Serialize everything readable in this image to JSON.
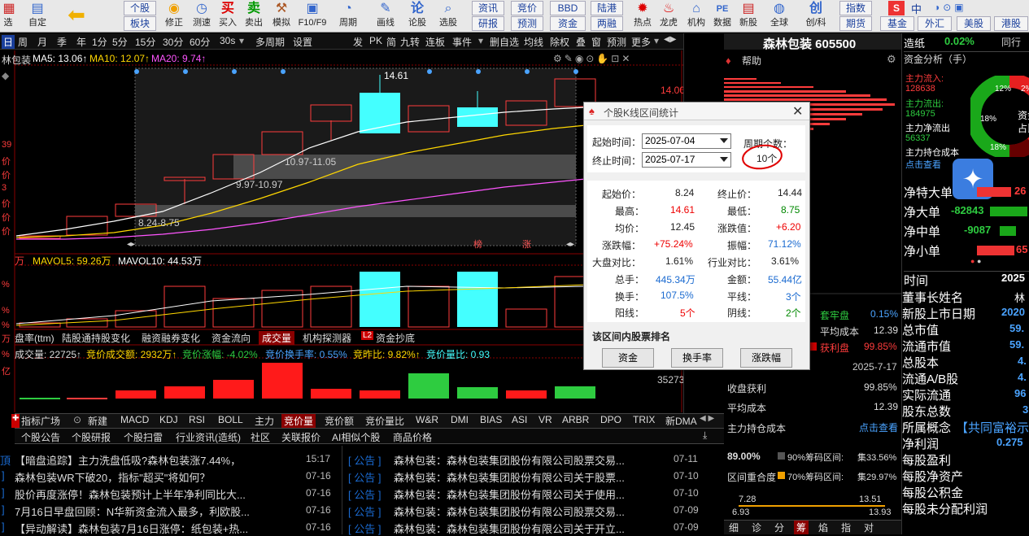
{
  "toolbar": {
    "left_items": [
      {
        "label": "选",
        "icon": "grid-icon"
      },
      {
        "label": "自定",
        "icon": "custom-icon"
      },
      {
        "label": "",
        "icon": "back-arrow-icon"
      },
      {
        "label": "修正",
        "icon": "refresh-icon"
      },
      {
        "label": "测速",
        "icon": "clock-icon"
      },
      {
        "label": "买入",
        "icon": "buy-icon"
      },
      {
        "label": "卖出",
        "icon": "sell-icon"
      },
      {
        "label": "模拟",
        "icon": "hammer-icon"
      },
      {
        "label": "F10/F9",
        "icon": "f10-icon"
      },
      {
        "label": "周期",
        "icon": "period-icon"
      },
      {
        "label": "画线",
        "icon": "draw-icon"
      },
      {
        "label": "论股",
        "icon": "discuss-icon"
      },
      {
        "label": "选股",
        "icon": "select-stock-icon"
      }
    ],
    "small_buttons": {
      "gegu": "个股",
      "bankuai": "板块",
      "zixun": "资讯",
      "yanbao": "研报",
      "jingjia": "竞价",
      "yuce": "预测",
      "bbd": "BBD",
      "zijin": "资金",
      "lugang": "陆港",
      "lianglong": "两融"
    },
    "right_items": [
      {
        "label": "热点",
        "icon": "hot-icon"
      },
      {
        "label": "龙虎",
        "icon": "dragon-icon"
      },
      {
        "label": "机构",
        "icon": "bank-icon"
      },
      {
        "label": "数据",
        "icon": "pe-icon"
      },
      {
        "label": "新股",
        "icon": "new-stock-icon"
      },
      {
        "label": "全球",
        "icon": "globe-icon"
      },
      {
        "label": "创/科",
        "icon": "chuang-icon"
      }
    ],
    "far_right": {
      "zhishu": "指数",
      "qihuo": "期货",
      "jijin": "基金",
      "waihui": "外汇",
      "meigu": "美股",
      "ganggu": "港股",
      "zhong": "中"
    }
  },
  "menubar": {
    "items": [
      "日",
      "周",
      "月",
      "季",
      "年",
      "1分",
      "5分",
      "15分",
      "30分",
      "60分",
      "30s",
      "多周期",
      "设置",
      "发",
      "PK",
      "简",
      "九转",
      "连板",
      "事件",
      "删自选",
      "均线",
      "除权",
      "叠",
      "窗",
      "预测",
      "更多"
    ]
  },
  "main_chart": {
    "ma_line": {
      "name": "林包装",
      "ma5": "MA5: 13.06↑",
      "ma10": "MA10: 12.07↑",
      "ma20": "MA20: 9.74↑"
    },
    "price_labels": {
      "p1461": "14.61",
      "p1400": "14.00",
      "z1": "10.97-11.05",
      "z2": "9.97-10.97",
      "z3": "8.24-8.75"
    },
    "markers": {
      "bang": "榜",
      "zhang": "涨"
    },
    "left_edge": [
      "39",
      "价",
      "价",
      "3",
      "价",
      "价",
      "价"
    ]
  },
  "volume_pane": {
    "header_unit": "万",
    "mavol5": "MAVOL5: 59.26万",
    "mavol10": "MAVOL10: 44.53万",
    "left_edge": [
      "%",
      "%",
      "%",
      "%",
      "万",
      "亿"
    ]
  },
  "sub_tabs": [
    "盘率(ttm)",
    "陆股通持股变化",
    "融资融券变化",
    "资金流向",
    "成交量",
    "机构探测器",
    "资金抄底"
  ],
  "auction_pane": {
    "text": "成交量: 22725↑",
    "amount": "竞价成交额: 2932万↑",
    "rise": "竞价涨幅: -4.02%",
    "turnover": "竞价换手率: 0.55%",
    "zhanbi": "竞昨比: 9.82%↑",
    "liangbi": "竞价量比: 0.93",
    "right_value": "35273"
  },
  "indicator_tabs": [
    "指标广场",
    "新建",
    "MACD",
    "KDJ",
    "RSI",
    "BOLL",
    "主力",
    "竞价量",
    "竞价额",
    "竞价量比",
    "W&R",
    "DMI",
    "BIAS",
    "ASI",
    "VR",
    "ARBR",
    "DPO",
    "TRIX",
    "新DMA"
  ],
  "info_tabs": [
    "个股公告",
    "个股研报",
    "个股扫雷",
    "行业资讯(造纸)",
    "社区",
    "关联报价",
    "AI相似个股",
    "商品价格"
  ],
  "news_left": [
    {
      "text": "【暗盘追踪】主力洗盘低吸?森林包装涨7.44%，",
      "time": "15:17"
    },
    {
      "text": "森林包装WR下破20，指标\"超买\"将如何？",
      "time": "07-16"
    },
    {
      "text": "股价再度涨停！森林包装预计上半年净利同比大...",
      "time": "07-16"
    },
    {
      "text": "7月16日早盘回顾：N华新资金流入最多，利欧股...",
      "time": "07-16"
    },
    {
      "text": "【异动解读】森林包装7月16日涨停：纸包装+热...",
      "time": "07-16"
    }
  ],
  "news_right": [
    {
      "tag": "公告",
      "text": "森林包装：森林包装集团股份有限公司股票交易...",
      "time": "07-11"
    },
    {
      "tag": "公告",
      "text": "森林包装：森林包装集团股份有限公司关于股票...",
      "time": "07-10"
    },
    {
      "tag": "公告",
      "text": "森林包装：森林包装集团股份有限公司关于使用...",
      "time": "07-10"
    },
    {
      "tag": "公告",
      "text": "森林包装：森林包装集团股份有限公司股票交易...",
      "time": "07-09"
    },
    {
      "tag": "公告",
      "text": "森林包装：森林包装集团股份有限公司关于开立...",
      "time": "07-09"
    }
  ],
  "dialog": {
    "title": "个股K线区间统计",
    "start_label": "起始时间：",
    "start_value": "2025-07-04",
    "end_label": "终止时间：",
    "end_value": "2025-07-17",
    "period_label": "周期个数：",
    "period_value": "10个",
    "stats_left": [
      [
        "起始价：",
        "8.24"
      ],
      [
        "最高：",
        "14.61"
      ],
      [
        "均价：",
        "12.45"
      ],
      [
        "涨跌幅：",
        "+75.24%"
      ],
      [
        "大盘对比：",
        "1.61%"
      ],
      [
        "总手：",
        "445.34万"
      ],
      [
        "换手：",
        "107.5%"
      ],
      [
        "阳线：",
        "5个"
      ]
    ],
    "stats_right": [
      [
        "终止价：",
        "14.44"
      ],
      [
        "最低：",
        "8.75"
      ],
      [
        "涨跌值：",
        "+6.20"
      ],
      [
        "振幅：",
        "71.12%"
      ],
      [
        "行业对比：",
        "3.61%"
      ],
      [
        "金额：",
        "55.44亿"
      ],
      [
        "平线：",
        "3个"
      ],
      [
        "阴线：",
        "2个"
      ]
    ],
    "rank_title": "该区间内股票排名",
    "buttons": [
      "资金",
      "换手率",
      "涨跌幅"
    ]
  },
  "right_panel": {
    "title": "森林包装 605500",
    "help": "帮助",
    "chip": {
      "gain_label": "收盘获利",
      "gain": "99.85%",
      "cost_label": "平均成本",
      "cost": "12.39",
      "holding": "主力持仓成本",
      "click": "点击查看",
      "date": "2025-7-17",
      "tao_label": "套牢盘",
      "tao": "0.15%",
      "avg_label": "平均成本",
      "avg": "12.39",
      "huo_label": "获利盘",
      "huo": "99.85%",
      "c90": "89.00%",
      "c90_label": "90%筹码区间:",
      "c90_v": "集33.56%",
      "overlap": "区间重合度",
      "c70_label": "70%筹码区间:",
      "c70_v": "集29.97%",
      "lo1": "7.28",
      "hi1": "13.51",
      "lo2": "6.93",
      "hi2": "13.93"
    },
    "bottom_tabs": [
      "细",
      "诊",
      "分",
      "筹",
      "焰",
      "指",
      "对"
    ]
  },
  "far_right_panel": {
    "sector": "造纸",
    "sector_pct": "0.02%",
    "tong": "同行",
    "capital_title": "资金分析（手）",
    "inflow_label": "主力流入:",
    "inflow": "128638",
    "outflow_label": "主力流出:",
    "outflow": "184975",
    "net_label": "主力净流出",
    "net": "56337",
    "cost_label": "主力持仓成本",
    "cost_click": "点击查看",
    "pie": {
      "title1": "资金",
      "title2": "占比",
      "slices": [
        [
          "12%",
          12
        ],
        [
          "2%",
          2
        ],
        [
          "18%",
          18
        ],
        [
          "18%",
          18
        ]
      ]
    },
    "flows": [
      [
        "净特大单",
        "26"
      ],
      [
        "净大单",
        "-82843"
      ],
      [
        "净中单",
        "-9087"
      ],
      [
        "净小单",
        "65"
      ]
    ],
    "time_label": "时间",
    "time_val": "2025",
    "f10": [
      [
        "董事长姓名",
        "林"
      ],
      [
        "新股上市日期",
        "2020"
      ],
      [
        "总市值",
        "59."
      ],
      [
        "流通市值",
        "59."
      ],
      [
        "总股本",
        "4."
      ],
      [
        "流通A/B股",
        "4."
      ],
      [
        "实际流通",
        "96"
      ],
      [
        "股东总数",
        "3"
      ],
      [
        "所属概念",
        "【共同富裕示"
      ],
      [
        "净利润",
        "0.275"
      ],
      [
        "每股盈利",
        ""
      ],
      [
        "每股净资产",
        ""
      ],
      [
        "每股公积金",
        ""
      ],
      [
        "每股未分配利润",
        ""
      ]
    ]
  }
}
